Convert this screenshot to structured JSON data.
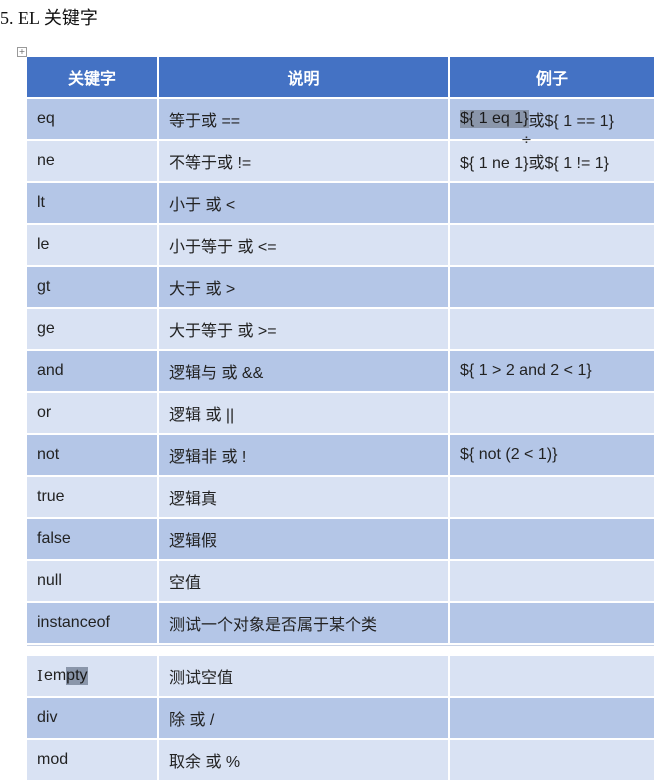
{
  "heading": "5. EL 关键字",
  "table": {
    "headers": [
      "关键字",
      "说明",
      "例子"
    ],
    "rows": [
      {
        "keyword": "eq",
        "desc": "等于或 ==",
        "example_hl": "${ 1 eq 1}",
        "example": "或${ 1 == 1}"
      },
      {
        "keyword": "ne",
        "desc": "不等于或 !=",
        "example": "${ 1 ne 1}或${ 1 != 1}"
      },
      {
        "keyword": "lt",
        "desc": "小于 或 <",
        "example": ""
      },
      {
        "keyword": "le",
        "desc": "小于等于 或 <=",
        "example": ""
      },
      {
        "keyword": "gt",
        "desc": "大于 或 >",
        "example": ""
      },
      {
        "keyword": "ge",
        "desc": "大于等于 或 >=",
        "example": ""
      },
      {
        "keyword": "and",
        "desc": "逻辑与 或 &&",
        "example": "${ 1 > 2 and 2 < 1}"
      },
      {
        "keyword": "or",
        "desc": "逻辑 或 ||",
        "example": ""
      },
      {
        "keyword": "not",
        "desc": "逻辑非 或 !",
        "example": "${ not (2 < 1)}"
      },
      {
        "keyword": "true",
        "desc": "逻辑真",
        "example": ""
      },
      {
        "keyword": "false",
        "desc": "逻辑假",
        "example": ""
      },
      {
        "keyword": "null",
        "desc": "空值",
        "example": ""
      },
      {
        "keyword": "instanceof",
        "desc": "测试一个对象是否属于某个类",
        "example": ""
      },
      {
        "keyword_pre": "em",
        "keyword_hl": "pty",
        "desc": "测试空值",
        "example": ""
      },
      {
        "keyword": "div",
        "desc": "除 或 /",
        "example": ""
      },
      {
        "keyword": "mod",
        "desc": "取余 或 %",
        "example": ""
      }
    ]
  }
}
